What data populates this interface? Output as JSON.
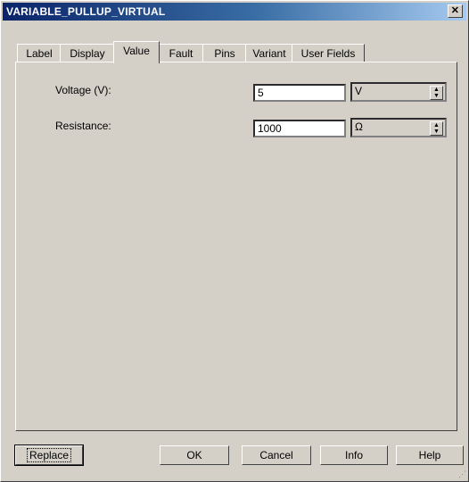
{
  "window": {
    "title": "VARIABLE_PULLUP_VIRTUAL",
    "close_glyph": "✕"
  },
  "tabs": [
    {
      "label": "Label",
      "active": false
    },
    {
      "label": "Display",
      "active": false
    },
    {
      "label": "Value",
      "active": true
    },
    {
      "label": "Fault",
      "active": false
    },
    {
      "label": "Pins",
      "active": false
    },
    {
      "label": "Variant",
      "active": false
    },
    {
      "label": "User Fields",
      "active": false
    }
  ],
  "fields": {
    "voltage": {
      "label": "Voltage (V):",
      "value": "5",
      "unit": "V"
    },
    "resistance": {
      "label": "Resistance:",
      "value": "1000",
      "unit": "Ω"
    }
  },
  "buttons": {
    "replace": "Replace",
    "ok": "OK",
    "cancel": "Cancel",
    "info": "Info",
    "help": "Help"
  }
}
